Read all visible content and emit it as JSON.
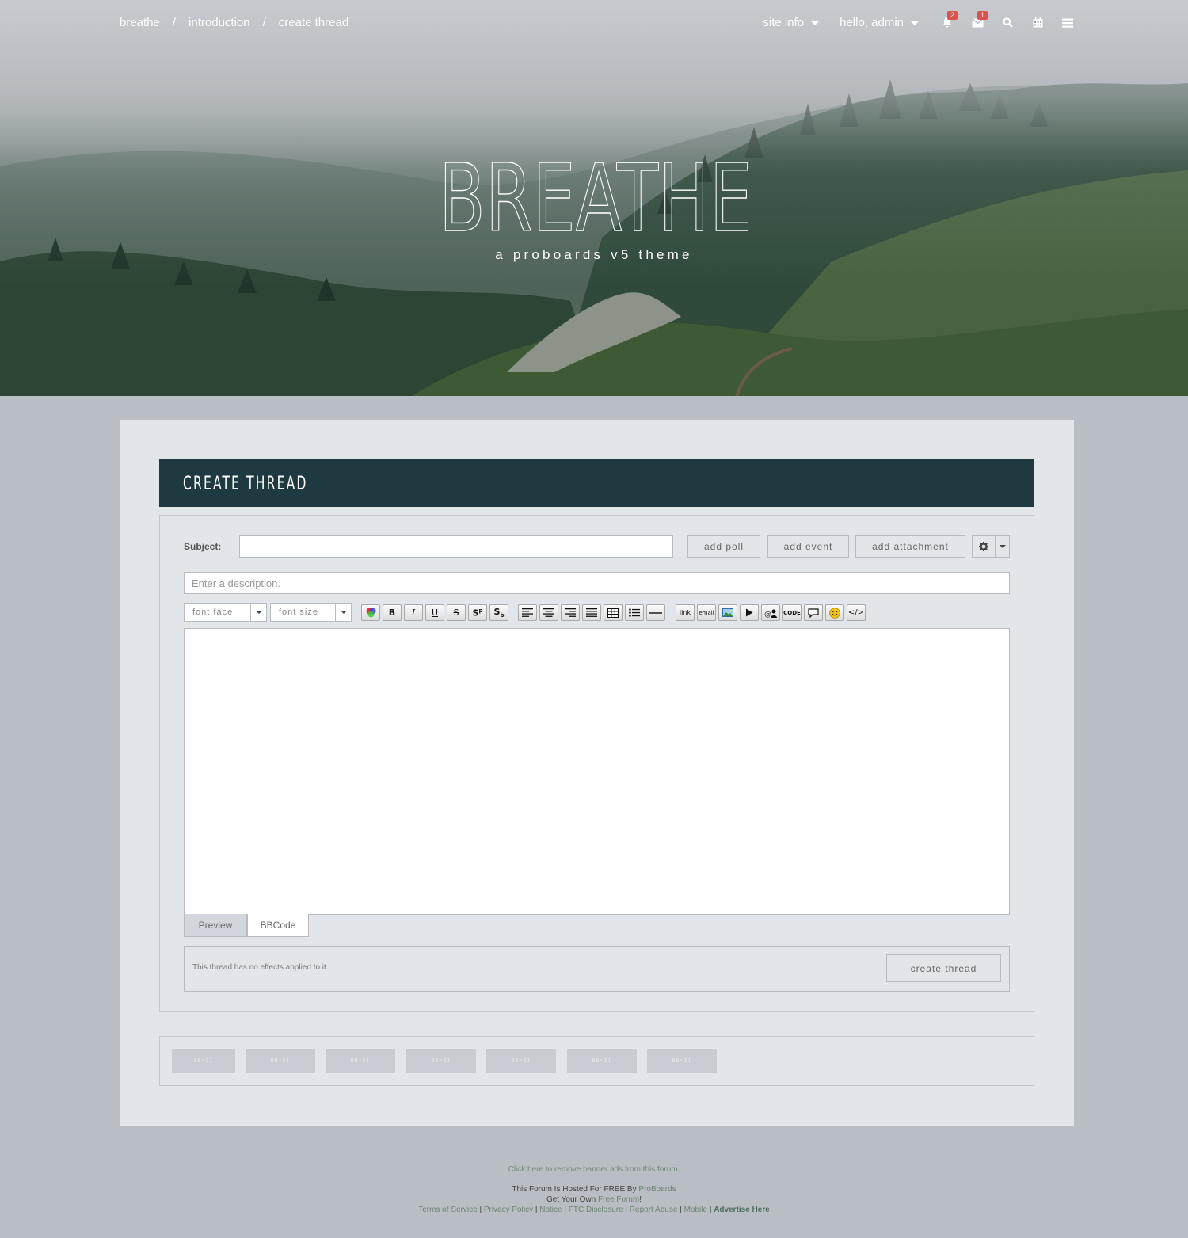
{
  "nav": {
    "breadcrumbs": [
      "breathe",
      "introduction",
      "create thread"
    ],
    "separator": "/",
    "site_info": "site info",
    "greeting": "hello, admin",
    "notifications_count": "2",
    "messages_count": "1",
    "icons": [
      "bell-icon",
      "envelope-icon",
      "search-icon",
      "calendar-icon",
      "menu-icon"
    ]
  },
  "hero": {
    "title": "BREATHE",
    "subtitle": "a proboards v5 theme"
  },
  "form": {
    "header": "CREATE THREAD",
    "subject_label": "Subject:",
    "subject_value": "",
    "buttons": {
      "add_poll": "add poll",
      "add_event": "add event",
      "add_attachment": "add attachment"
    },
    "description_placeholder": "Enter a description.",
    "font_face": "font face",
    "font_size": "font size",
    "toolbar_buttons": [
      "color",
      "B",
      "I",
      "U",
      "S",
      "S sup",
      "S sub",
      "align-left",
      "align-center",
      "align-right",
      "justify",
      "table",
      "list",
      "hr",
      "link",
      "email",
      "image",
      "video",
      "mention",
      "CODE",
      "quote",
      "smiley",
      "</>"
    ],
    "tabs": [
      "Preview",
      "BBCode"
    ],
    "effects_text": "This thread has no effects applied to it.",
    "submit": "create thread"
  },
  "badges": [
    "88×31",
    "88×31",
    "88×31",
    "88×31",
    "88×31",
    "88×31",
    "88×31"
  ],
  "footer": {
    "remove_ads": "Click here to remove banner ads from this forum.",
    "hosted_prefix": "This Forum Is Hosted For FREE By ",
    "hosted_link": "ProBoards",
    "own_prefix": "Get Your Own ",
    "own_link": "Free Forum",
    "own_suffix": "!",
    "links": [
      "Terms of Service",
      "Privacy Policy",
      "Notice",
      "FTC Disclosure",
      "Report Abuse",
      "Mobile"
    ],
    "advertise": "Advertise Here"
  },
  "colors": {
    "header_bar": "#1e3a40",
    "panel": "#e2e5ea",
    "page_bg": "#b9bdc4",
    "badge_red": "#d9534f",
    "footer_link": "#6d8474"
  }
}
